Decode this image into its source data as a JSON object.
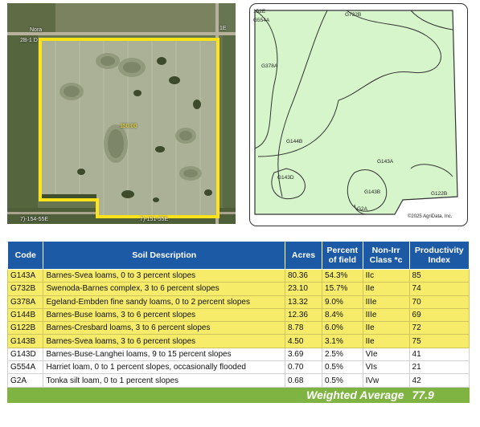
{
  "aerial": {
    "labels": {
      "road_top_left": "Nora",
      "road_left": "2B-1 D",
      "road_right": "1E",
      "field_acres": "150.00",
      "bottom_left": "7)-154-55E",
      "bottom_mid": "7)-151-55E"
    },
    "colors": {
      "boundary": "#ffe21a"
    }
  },
  "soilmap": {
    "labels": {
      "g554a": "G554A",
      "top_left": "152E",
      "g732b": "G732B",
      "g378a": "G378A",
      "g144b": "G144B",
      "g143d": "G143D",
      "g143a": "G143A",
      "g143b": "G143B",
      "g122b": "G122B",
      "g2a": "G2A",
      "copyright": "©2025 AgriData, Inc."
    },
    "colors": {
      "fill": "#d6f5cb",
      "line": "#333333"
    }
  },
  "table": {
    "headers": {
      "code": "Code",
      "desc": "Soil Description",
      "acres": "Acres",
      "pct": "Percent of field",
      "cls": "Non-Irr Class *c",
      "pi": "Productivity Index"
    },
    "rows": [
      {
        "code": "G143A",
        "desc": "Barnes-Svea loams, 0 to 3 percent slopes",
        "acres": "80.36",
        "pct": "54.3%",
        "cls": "IIc",
        "pi": "85"
      },
      {
        "code": "G732B",
        "desc": "Swenoda-Barnes complex, 3 to 6 percent slopes",
        "acres": "23.10",
        "pct": "15.7%",
        "cls": "IIe",
        "pi": "74"
      },
      {
        "code": "G378A",
        "desc": "Egeland-Embden fine sandy loams, 0 to 2 percent slopes",
        "acres": "13.32",
        "pct": "9.0%",
        "cls": "IIIe",
        "pi": "70"
      },
      {
        "code": "G144B",
        "desc": "Barnes-Buse loams, 3 to 6 percent slopes",
        "acres": "12.36",
        "pct": "8.4%",
        "cls": "IIIe",
        "pi": "69"
      },
      {
        "code": "G122B",
        "desc": "Barnes-Cresbard loams, 3 to 6 percent slopes",
        "acres": "8.78",
        "pct": "6.0%",
        "cls": "IIe",
        "pi": "72"
      },
      {
        "code": "G143B",
        "desc": "Barnes-Svea loams, 3 to 6 percent slopes",
        "acres": "4.50",
        "pct": "3.1%",
        "cls": "IIe",
        "pi": "75"
      },
      {
        "code": "G143D",
        "desc": "Barnes-Buse-Langhei loams, 9 to 15 percent slopes",
        "acres": "3.69",
        "pct": "2.5%",
        "cls": "VIe",
        "pi": "41"
      },
      {
        "code": "G554A",
        "desc": "Harriet loam, 0 to 1 percent slopes, occasionally flooded",
        "acres": "0.70",
        "pct": "0.5%",
        "cls": "VIs",
        "pi": "21"
      },
      {
        "code": "G2A",
        "desc": "Tonka silt loam, 0 to 1 percent slopes",
        "acres": "0.68",
        "pct": "0.5%",
        "cls": "IVw",
        "pi": "42"
      }
    ],
    "footer": {
      "label": "Weighted Average",
      "value": "77.9"
    },
    "colors": {
      "header_bg": "#1d5aa6",
      "highlight_bg": "#f6ec6a",
      "footer_bg": "#7fb342"
    }
  }
}
